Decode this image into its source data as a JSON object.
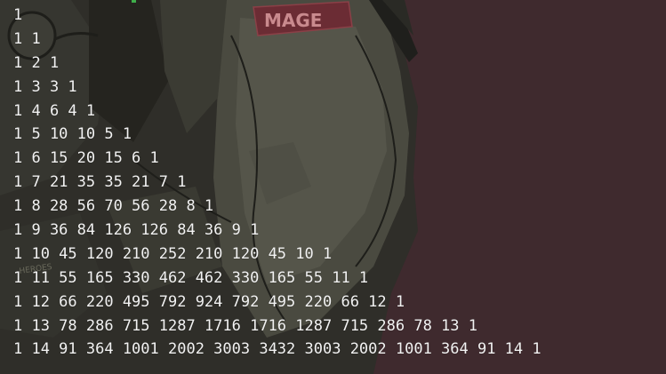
{
  "wallpaper": {
    "badge_text": "MAGE",
    "sleeve_text": "HEROES"
  },
  "colors": {
    "background": "#3f2a2e",
    "text": "#f2f2f2",
    "art_shadow": "#2b2a26",
    "art_mid": "#4a4a3f",
    "art_light": "#5a5a4d",
    "badge": "#6b2c34"
  },
  "terminal": {
    "lines": [
      "1",
      "1 1",
      "1 2 1",
      "1 3 3 1",
      "1 4 6 4 1",
      "1 5 10 10 5 1",
      "1 6 15 20 15 6 1",
      "1 7 21 35 35 21 7 1",
      "1 8 28 56 70 56 28 8 1",
      "1 9 36 84 126 126 84 36 9 1",
      "1 10 45 120 210 252 210 120 45 10 1",
      "1 11 55 165 330 462 462 330 165 55 11 1",
      "1 12 66 220 495 792 924 792 495 220 66 12 1",
      "1 13 78 286 715 1287 1716 1716 1287 715 286 78 13 1",
      "1 14 91 364 1001 2002 3003 3432 3003 2002 1001 364 91 14 1"
    ]
  }
}
